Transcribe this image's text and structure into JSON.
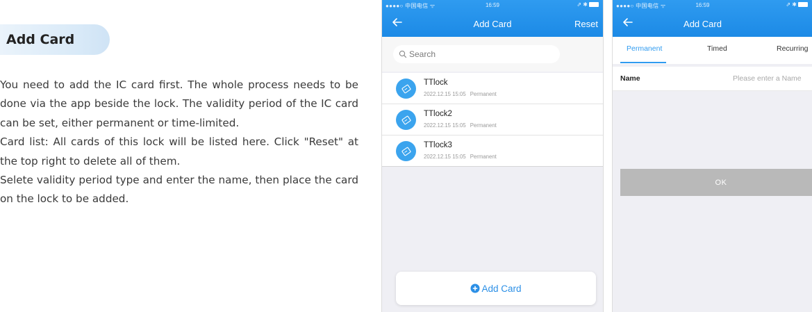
{
  "section": {
    "title": "Add Card"
  },
  "body": {
    "paragraphs": [
      "You need to add the IC card first. The whole process needs to be done via the app beside the lock. The validity period of the IC card can be set, either permanent or time-limited.",
      "Card list: All cards of this lock will be listed here. Click \"Reset\" at the top right to delete all of them.",
      "Selete validity period type and enter the name, then place the card on the lock to be added."
    ]
  },
  "phone_list": {
    "status": {
      "carrier": "●●●●○ 中国电信 ᯤ",
      "time": "16:59",
      "right": "⇗ ✱"
    },
    "title": "Add Card",
    "reset_label": "Reset",
    "search_placeholder": "Search",
    "cards": [
      {
        "name": "TTlock",
        "date": "2022.12.15 15:05",
        "type": "Permanent"
      },
      {
        "name": "TTlock2",
        "date": "2022.12.15 15:05",
        "type": "Permanent"
      },
      {
        "name": "TTlock3",
        "date": "2022.12.15 15:05",
        "type": "Permanent"
      }
    ],
    "add_button_label": "Add Card"
  },
  "phone_form": {
    "status": {
      "carrier": "●●●●○ 中国电信 ᯤ",
      "time": "16:59",
      "right": "⇗ ✱"
    },
    "title": "Add Card",
    "tabs": [
      "Permanent",
      "Timed",
      "Recurring"
    ],
    "name_label": "Name",
    "name_placeholder": "Please enter a Name",
    "ok_label": "OK"
  },
  "colors": {
    "accent": "#2f9bf0",
    "ok_disabled": "#b9b9b9",
    "pill": "#d9eaf8"
  }
}
